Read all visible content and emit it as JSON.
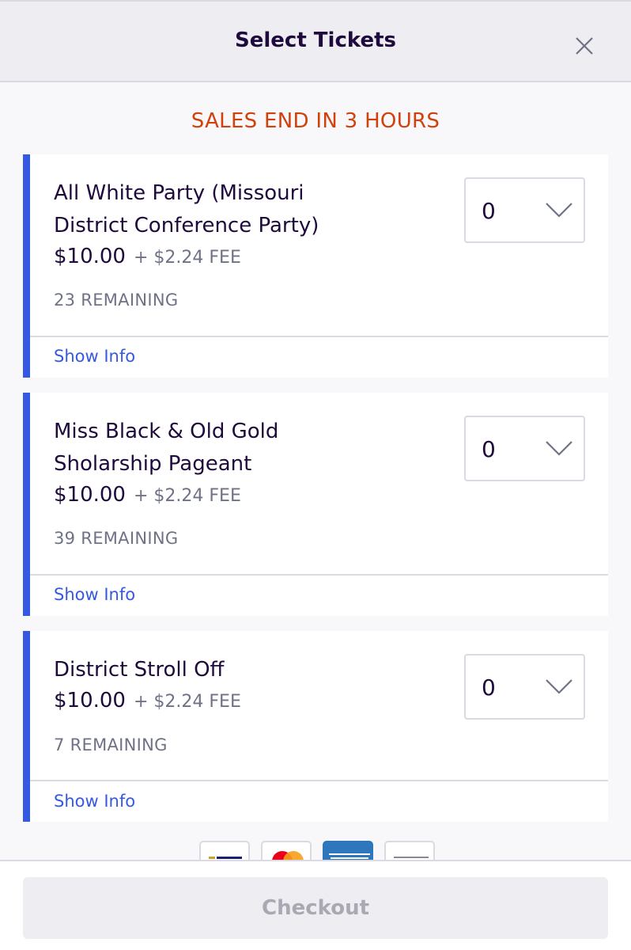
{
  "header": {
    "title": "Select Tickets",
    "close_icon": "close-icon"
  },
  "sales_banner": "SALES END IN 3 HOURS",
  "tickets": [
    {
      "name_line1": "All White Party (Missouri",
      "name_line2": "District Conference Party)",
      "price": "$10.00",
      "fee": "+ $2.24 FEE",
      "remaining": "23 REMAINING",
      "quantity": "0",
      "show_info": "Show Info"
    },
    {
      "name_line1": "Miss Black & Old Gold",
      "name_line2": "Sholarship Pageant",
      "price": "$10.00",
      "fee": "+ $2.24 FEE",
      "remaining": "39 REMAINING",
      "quantity": "0",
      "show_info": "Show Info"
    },
    {
      "name_line1": "District Stroll Off",
      "price": "$10.00",
      "fee": "+ $2.24 FEE",
      "remaining": "7 REMAINING",
      "quantity": "0",
      "show_info": "Show Info"
    }
  ],
  "payment_icons": [
    "visa-icon",
    "mastercard-icon",
    "american-express-icon",
    "discover-icon"
  ],
  "footer": {
    "checkout_label": "Checkout"
  },
  "colors": {
    "accent": "#3659e3",
    "sales_banner": "#d1410c",
    "text_primary": "#1e0a3c",
    "text_secondary": "#6f7287",
    "checkout_disabled_bg": "#eeedf2",
    "checkout_disabled_text": "#a9a8b3"
  }
}
